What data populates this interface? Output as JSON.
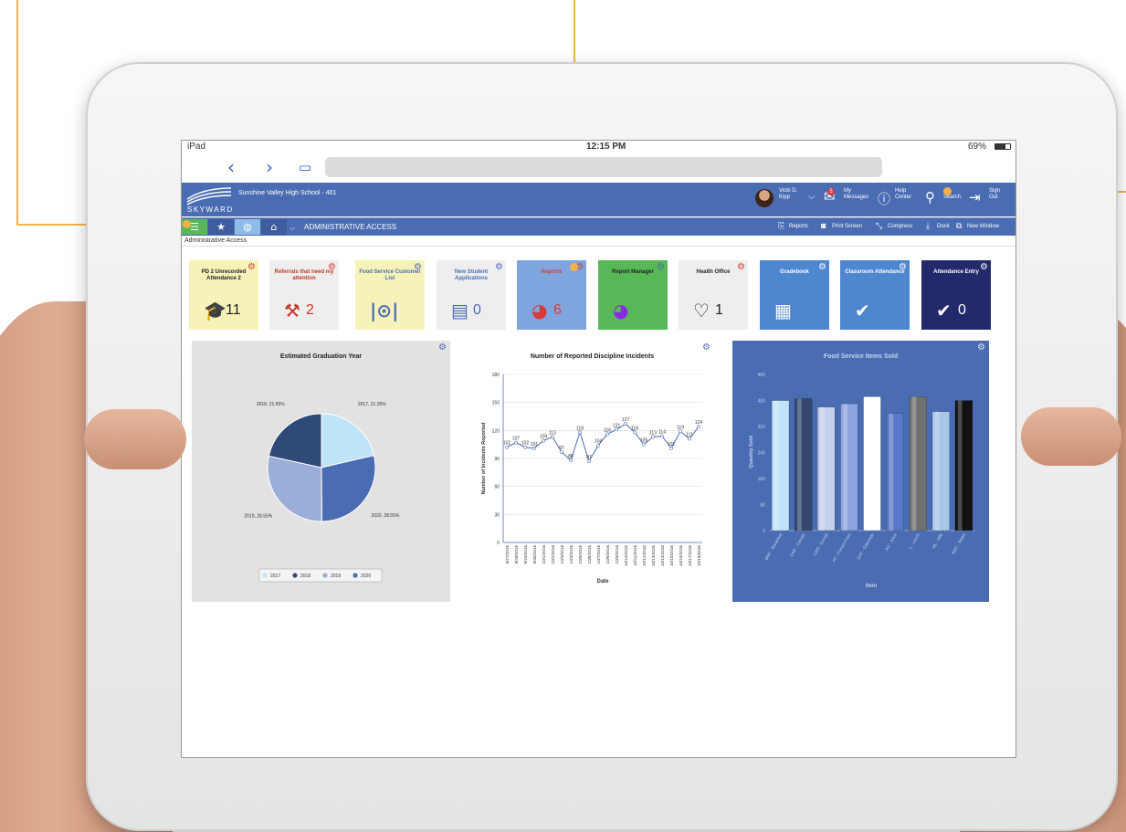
{
  "status": {
    "device": "iPad",
    "time": "12:15 PM",
    "battery": "69%"
  },
  "header": {
    "school": "Sunshine Valley High School - 401",
    "logo_text": "SKYWARD",
    "user_first": "Vicki D.",
    "user_last": "Kipp",
    "messages_1": "My",
    "messages_2": "Messages",
    "messages_badge": "5",
    "help_1": "Help",
    "help_2": "Center",
    "search": "Search",
    "signout_1": "Sign",
    "signout_2": "Out"
  },
  "toolbar": {
    "title": "ADMINISTRATIVE ACCESS",
    "reports": "Reports",
    "print": "Print Screen",
    "compress": "Compress",
    "dock": "Dock",
    "new_window": "New Window"
  },
  "breadcrumb": "Administrative Access",
  "tiles": [
    {
      "label": "PD 2 Unrecorded Attendance 2",
      "count": "11",
      "bg": "#f7f3b8",
      "fg": "#222222",
      "icon": "graduation-check-icon"
    },
    {
      "label": "Referrals that need my attention",
      "count": "2",
      "bg": "#eeeeee",
      "fg": "#c0392b",
      "icon": "gavel-icon"
    },
    {
      "label": "Food Service Customer List",
      "count": "",
      "bg": "#f7f3b8",
      "fg": "#4a6cb3",
      "icon": "utensils-icon"
    },
    {
      "label": "New Student Applications",
      "count": "0",
      "bg": "#eeeeee",
      "fg": "#4a6cb3",
      "icon": "clipboard-icon"
    },
    {
      "label": "Reports",
      "count": "6",
      "bg": "#7fa5df",
      "fg": "#d63a3a",
      "icon": "pie-icon"
    },
    {
      "label": "Report Manager",
      "count": "",
      "bg": "#58b858",
      "fg": "#222222",
      "icon": "pie-icon"
    },
    {
      "label": "Health Office",
      "count": "1",
      "bg": "#eeeeee",
      "fg": "#222222",
      "icon": "heart-plus-icon"
    },
    {
      "label": "Gradebook",
      "count": "",
      "bg": "#4f86d0",
      "fg": "#ffffff",
      "icon": "gradebook-icon"
    },
    {
      "label": "Classroom Attendance",
      "count": "",
      "bg": "#4f86d0",
      "fg": "#ffffff",
      "icon": "attendance-icon"
    },
    {
      "label": "Attendance Entry",
      "count": "0",
      "bg": "#232a6b",
      "fg": "#ffffff",
      "icon": "attendance-icon"
    }
  ],
  "chart_data": [
    {
      "type": "pie",
      "title": "Estimated Graduation Year",
      "categories": [
        "2017",
        "2018",
        "2019",
        "2020"
      ],
      "values": [
        21.35,
        21.55,
        28.55,
        28.55
      ],
      "slice_labels": [
        "2017, 21.35%",
        "2018, 21.55%",
        "2019, 28.55%",
        "2020, 28.55%"
      ],
      "legend": [
        "2017",
        "2018",
        "2019",
        "2020"
      ],
      "legend_position": "bottom",
      "colors": [
        "#bfe3f7",
        "#2f4a78",
        "#9aaed8",
        "#4a6cb3"
      ]
    },
    {
      "type": "line",
      "title": "Number of Reported Discipline Incidents",
      "xlabel": "Date",
      "ylabel": "Number of Incidents Reported",
      "ylim": [
        0,
        180
      ],
      "yticks": [
        0,
        30,
        60,
        90,
        120,
        150,
        180
      ],
      "x": [
        "9/27/2016",
        "9/28/2016",
        "9/29/2016",
        "9/30/2016",
        "10/1/2016",
        "10/2/2016",
        "10/3/2016",
        "10/4/2016",
        "10/5/2016",
        "10/6/2016",
        "10/7/2016",
        "10/8/2016",
        "10/9/2016",
        "10/10/2016",
        "10/11/2016",
        "10/12/2016",
        "10/13/2016",
        "10/14/2016",
        "10/15/2016",
        "10/16/2016",
        "10/17/2016",
        "10/18/2016"
      ],
      "values": [
        102,
        107,
        102,
        101,
        109,
        113,
        97,
        88,
        118,
        87,
        104,
        116,
        121,
        127,
        118,
        105,
        113,
        114,
        101,
        119,
        111,
        124
      ],
      "grid": true,
      "color": "#4a6cb3"
    },
    {
      "type": "bar",
      "title": "Food Service Items Sold",
      "xlabel": "Item",
      "ylabel": "Quantity Sold",
      "ylim": [
        0,
        480
      ],
      "yticks": [
        0,
        80,
        160,
        240,
        320,
        400,
        480
      ],
      "categories": [
        "BRK - Breakfast",
        "CAR - Carrots",
        "CER - Cereal",
        "FF - French Fries",
        "GAT - Gatorade",
        "JUI - Juice",
        "L - Lunch",
        "ML - Milk",
        "WAT - Water"
      ],
      "values": [
        400,
        406,
        380,
        390,
        412,
        360,
        412,
        366,
        400
      ],
      "colors": [
        "#bfe3f7",
        "#32486e",
        "#c4cfea",
        "#8ea4e0",
        "#ffffff",
        "#5b79c9",
        "#6f6f6f",
        "#a8c6ea",
        "#111111"
      ],
      "background": "#4a6cb3"
    }
  ]
}
